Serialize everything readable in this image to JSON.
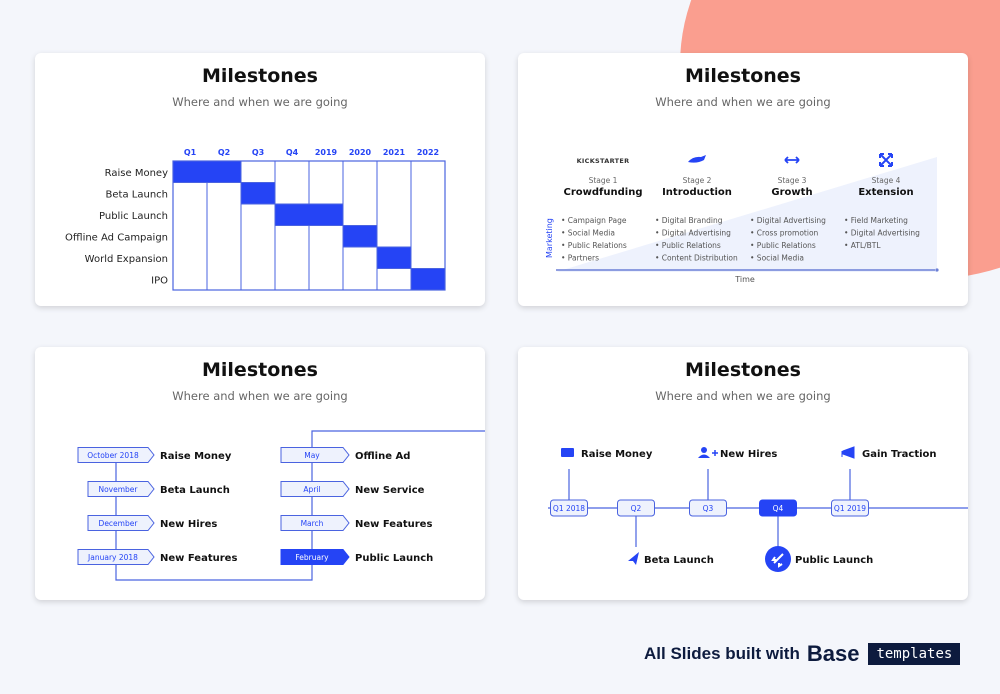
{
  "colors": {
    "accent": "#2544f5",
    "line": "#4a63e0",
    "light_fill": "#eef2fd",
    "background": "#f4f6fb",
    "blob": "#fa9e8f",
    "dark": "#0d1b3e"
  },
  "slides": [
    {
      "title": "Milestones",
      "subtitle": "Where and when we are going",
      "gantt": {
        "columns": [
          "Q1",
          "Q2",
          "Q3",
          "Q4",
          "2019",
          "2020",
          "2021",
          "2022"
        ],
        "rows": [
          {
            "label": "Raise Money",
            "start": 0,
            "end": 2
          },
          {
            "label": "Beta Launch",
            "start": 2,
            "end": 3
          },
          {
            "label": "Public Launch",
            "start": 3,
            "end": 5
          },
          {
            "label": "Offline Ad Campaign",
            "start": 5,
            "end": 6
          },
          {
            "label": "World Expansion",
            "start": 6,
            "end": 7
          },
          {
            "label": "IPO",
            "start": 7,
            "end": 8
          }
        ]
      }
    },
    {
      "title": "Milestones",
      "subtitle": "Where and when we are going",
      "y_axis_label": "Marketing",
      "x_axis_label": "Time",
      "stages": [
        {
          "icon": "kickstarter-logo",
          "logo_text": "KICKSTARTER",
          "stage": "Stage 1",
          "name": "Crowdfunding",
          "items": [
            "Campaign Page",
            "Social Media",
            "Public Relations",
            "Partners"
          ]
        },
        {
          "icon": "hand-icon",
          "stage": "Stage 2",
          "name": "Introduction",
          "items": [
            "Digital Branding",
            "Digital Advertising",
            "Public Relations",
            "Content Distribution"
          ]
        },
        {
          "icon": "arrows-horizontal-icon",
          "stage": "Stage 3",
          "name": "Growth",
          "items": [
            "Digital Advertising",
            "Cross promotion",
            "Public Relations",
            "Social Media"
          ]
        },
        {
          "icon": "expand-icon",
          "stage": "Stage 4",
          "name": "Extension",
          "items": [
            "Field Marketing",
            "Digital Advertising",
            "ATL/BTL"
          ]
        }
      ]
    },
    {
      "title": "Milestones",
      "subtitle": "Where and when we are going",
      "left_column": [
        {
          "date": "October 2018",
          "label": "Raise Money"
        },
        {
          "date": "November",
          "label": "Beta Launch"
        },
        {
          "date": "December",
          "label": "New Hires"
        },
        {
          "date": "January 2018",
          "label": "New Features"
        }
      ],
      "right_column": [
        {
          "date": "May",
          "label": "Offline Ad"
        },
        {
          "date": "April",
          "label": "New Service"
        },
        {
          "date": "March",
          "label": "New Features"
        },
        {
          "date": "February",
          "label": "Public Launch",
          "active": true
        }
      ]
    },
    {
      "title": "Milestones",
      "subtitle": "Where and when we are going",
      "nodes": [
        {
          "label": "Q1 2018",
          "event": "Raise Money",
          "icon": "money-icon",
          "position": "above"
        },
        {
          "label": "Q2",
          "event": "Beta Launch",
          "icon": "paper-plane-icon",
          "position": "below"
        },
        {
          "label": "Q3",
          "event": "New Hires",
          "icon": "add-user-icon",
          "position": "above"
        },
        {
          "label": "Q4",
          "event": "Public Launch",
          "icon": "rocket-icon",
          "position": "below",
          "active": true
        },
        {
          "label": "Q1 2019",
          "event": "Gain Traction",
          "icon": "megaphone-icon",
          "position": "above"
        }
      ]
    }
  ],
  "footer": {
    "text": "All Slides built with",
    "brand": "Base",
    "badge": "templates"
  }
}
